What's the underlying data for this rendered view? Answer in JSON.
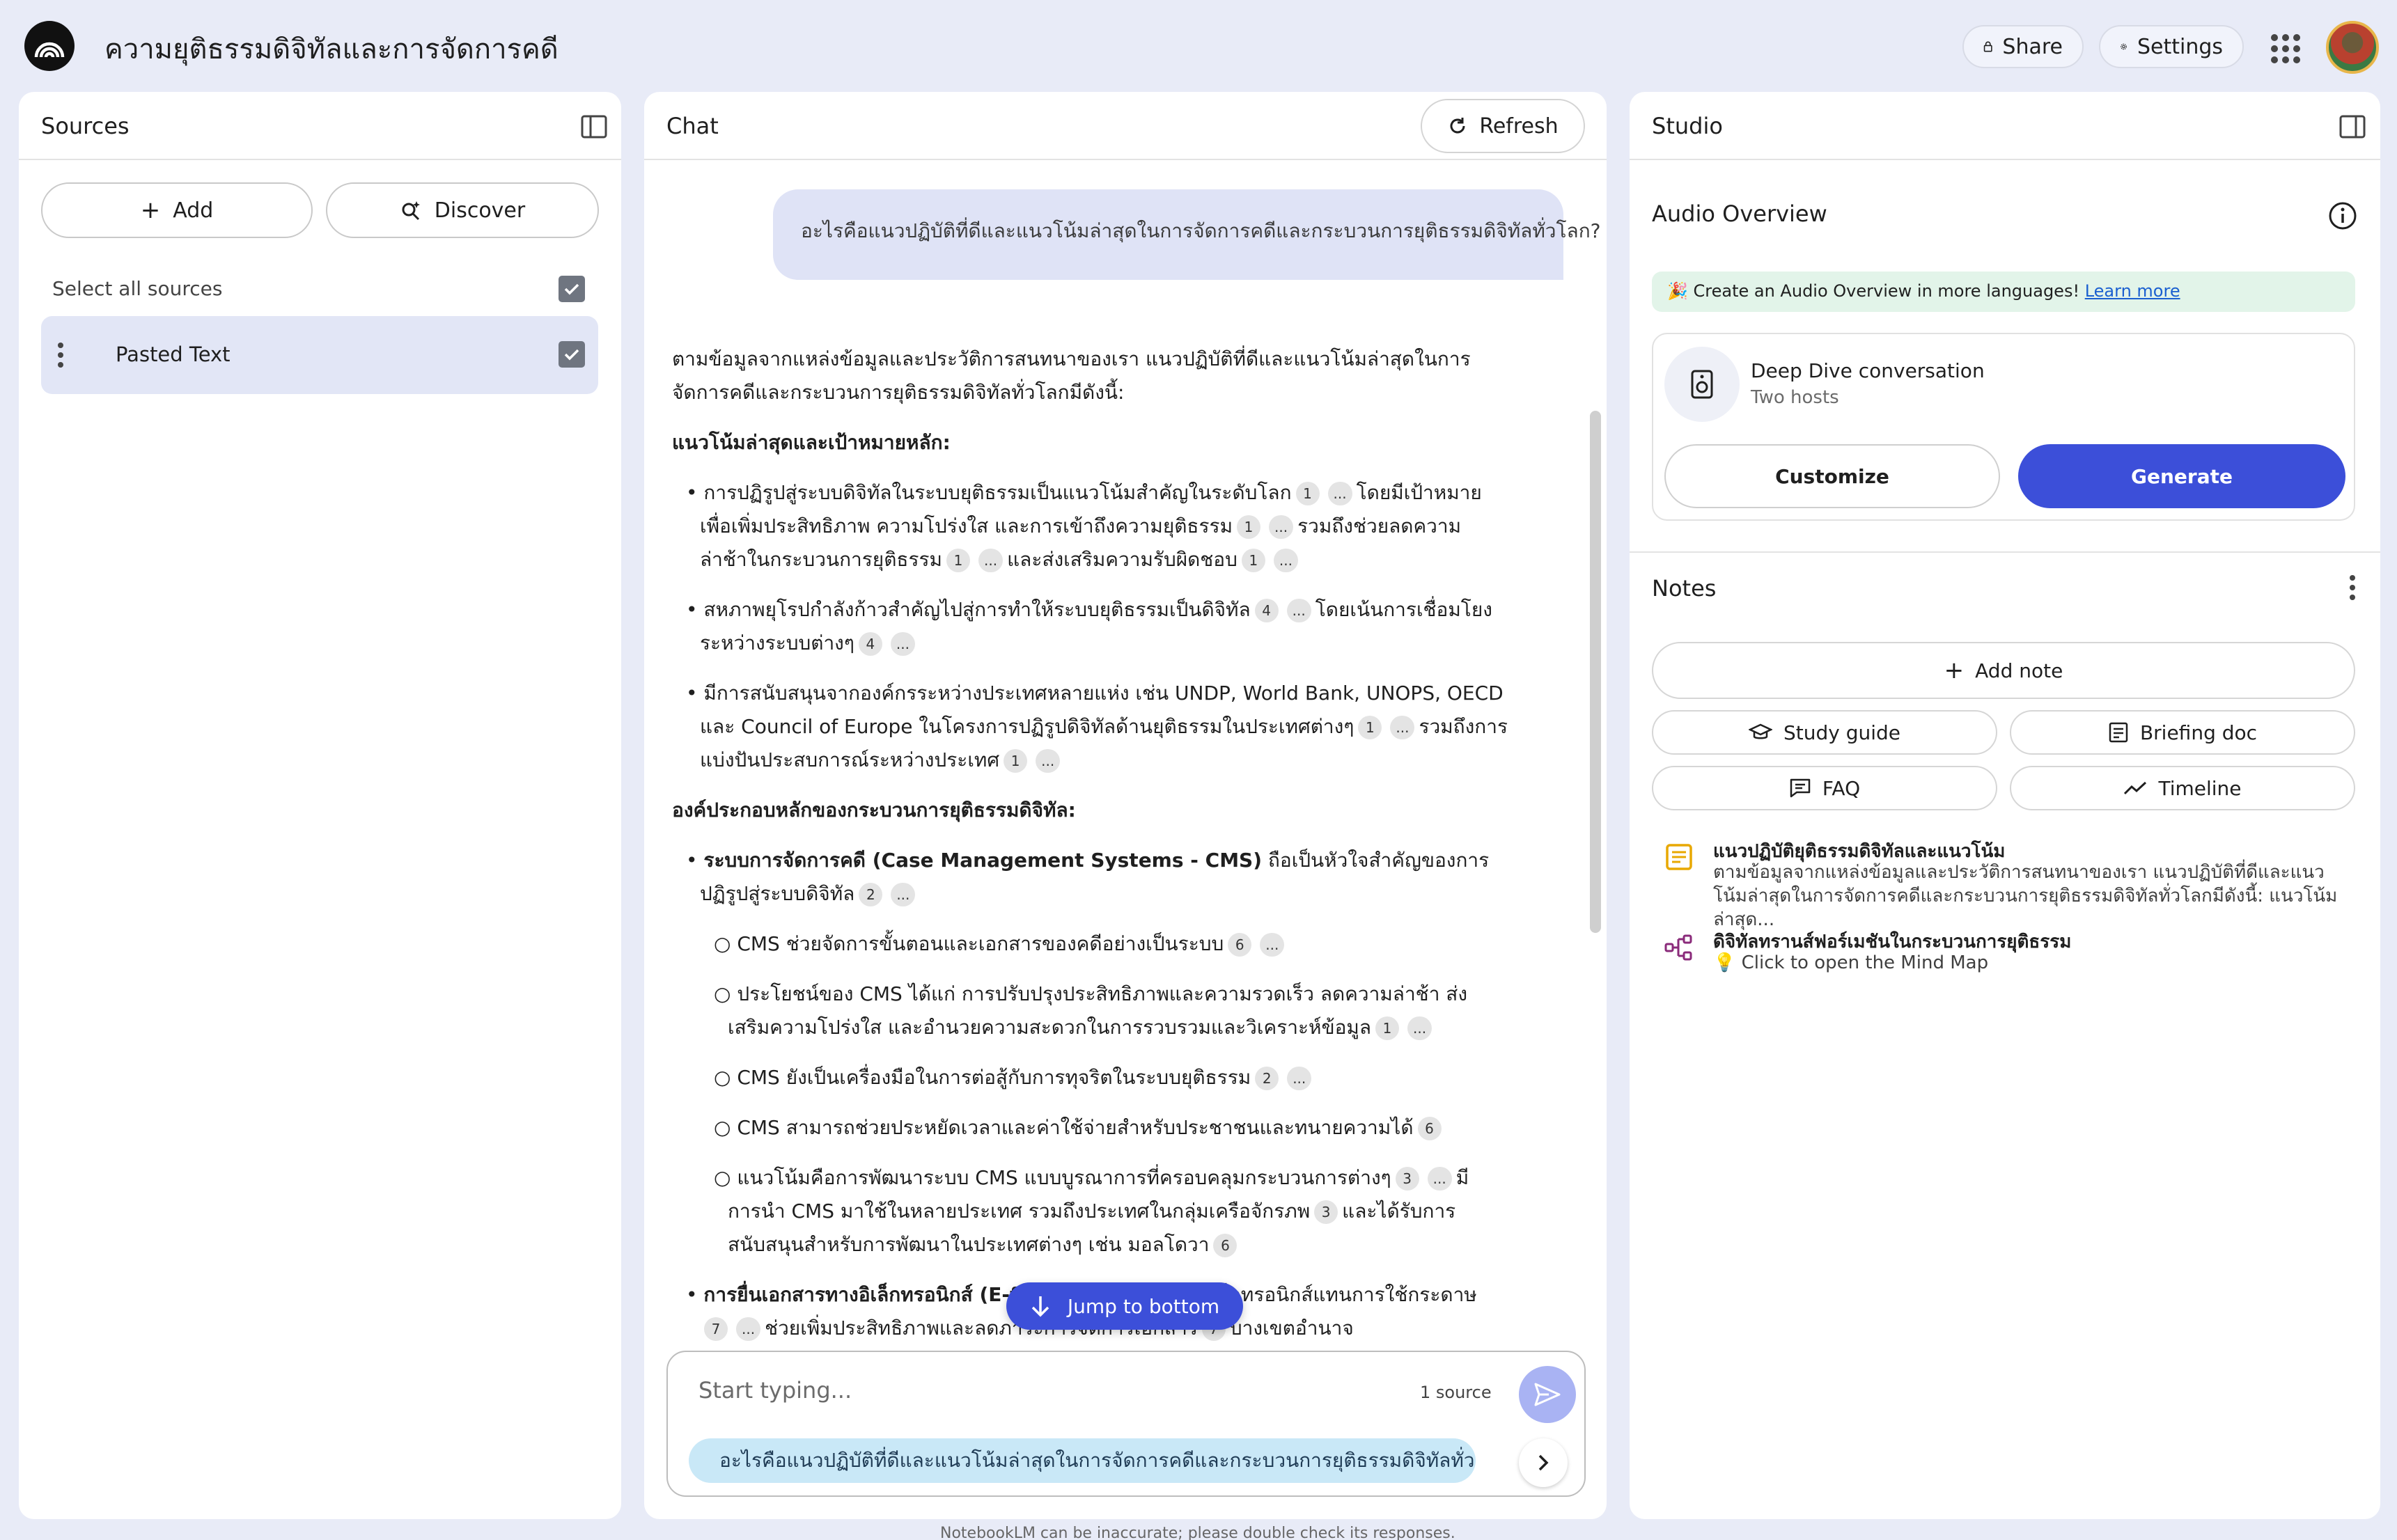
{
  "header": {
    "title": "ความยุติธรรมดิจิทัลและการจัดการคดี",
    "share_label": "Share",
    "settings_label": "Settings"
  },
  "sources": {
    "title": "Sources",
    "add_label": "Add",
    "discover_label": "Discover",
    "select_all_label": "Select all sources",
    "items": [
      {
        "label": "Pasted Text",
        "checked": true
      }
    ]
  },
  "chat": {
    "title": "Chat",
    "refresh_label": "Refresh",
    "user_question": "อะไรคือแนวปฏิบัติที่ดีและแนวโน้มล่าสุดในการจัดการคดีและกระบวนการยุติธรรมดิจิทัลทั่วโลก?",
    "answer": {
      "intro": "ตามข้อมูลจากแหล่งข้อมูลและประวัติการสนทนาของเรา แนวปฏิบัติที่ดีและแนวโน้มล่าสุดในการจัดการคดีและกระบวนการยุติธรรมดิจิทัลทั่วโลกมีดังนี้:",
      "h1": "แนวโน้มล่าสุดและเป้าหมายหลัก:",
      "b1": "การปฏิรูปสู่ระบบดิจิทัลในระบบยุติธรรมเป็นแนวโน้มสำคัญในระดับโลก",
      "b1b": "โดยมีเป้าหมายเพื่อเพิ่มประสิทธิภาพ ความโปร่งใส และการเข้าถึงความยุติธรรม",
      "b1c": "รวมถึงช่วยลดความล่าช้าในกระบวนการยุติธรรม",
      "b1d": "และส่งเสริมความรับผิดชอบ",
      "b2": "สหภาพยุโรปกำลังก้าวสำคัญไปสู่การทำให้ระบบยุติธรรมเป็นดิจิทัล",
      "b2b": "โดยเน้นการเชื่อมโยงระหว่างระบบต่างๆ",
      "b3": "มีการสนับสนุนจากองค์กรระหว่างประเทศหลายแห่ง เช่น UNDP, World Bank, UNOPS, OECD และ Council of Europe ในโครงการปฏิรูปดิจิทัลด้านยุติธรรมในประเทศต่างๆ",
      "b3b": "รวมถึงการแบ่งปันประสบการณ์ระหว่างประเทศ",
      "h2": "องค์ประกอบหลักของกระบวนการยุติธรรมดิจิทัล:",
      "b4_bold": "ระบบการจัดการคดี (Case Management Systems - CMS)",
      "b4": " ถือเป็นหัวใจสำคัญของการปฏิรูปสู่ระบบดิจิทัล",
      "s1": "CMS ช่วยจัดการขั้นตอนและเอกสารของคดีอย่างเป็นระบบ",
      "s2": "ประโยชน์ของ CMS ได้แก่ การปรับปรุงประสิทธิภาพและความรวดเร็ว ลดความล่าช้า ส่งเสริมความโปร่งใส และอำนวยความสะดวกในการรวบรวมและวิเคราะห์ข้อมูล",
      "s3": "CMS ยังเป็นเครื่องมือในการต่อสู้กับการทุจริตในระบบยุติธรรม",
      "s4": "CMS สามารถช่วยประหยัดเวลาและค่าใช้จ่ายสำหรับประชาชนและทนายความได้",
      "s5": "แนวโน้มคือการพัฒนาระบบ CMS แบบบูรณาการที่ครอบคลุมกระบวนการต่างๆ",
      "s5b": "มีการนำ CMS มาใช้ในหลายประเทศ รวมถึงประเทศในกลุ่มเครือจักรภพ",
      "s5c": "และได้รับการสนับสนุนสำหรับการพัฒนาในประเทศต่างๆ เช่น มอลโดวา",
      "b5_bold": "การยื่นเอกสารทางอิเล็กทรอนิกส์ (E-filing)",
      "b5": " และข้อมูลทางอิเล็กทรอนิกส์แทนการใช้กระดาษ",
      "b5b": "ช่วยเพิ่มประสิทธิภาพและลดภาระการจัดการเอกสาร",
      "b5c": "บางเขตอำนาจ",
      "c1": "1",
      "c2": "2",
      "c4": "4",
      "c6": "6",
      "c3": "3",
      "c7": "7",
      "more": "..."
    },
    "jump_label": "Jump to bottom",
    "input_placeholder": "Start typing...",
    "source_count": "1 source",
    "suggestion": "อะไรคือแนวปฏิบัติที่ดีและแนวโน้มล่าสุดในการจัดการคดีและกระบวนการยุติธรรมดิจิทัลทั่วโลก?",
    "disclaimer": "NotebookLM can be inaccurate; please double check its responses."
  },
  "studio": {
    "title": "Studio",
    "audio_title": "Audio Overview",
    "banner_text": "🎉 Create an Audio Overview in more languages! ",
    "banner_link": "Learn more",
    "deep_dive_title": "Deep Dive conversation",
    "deep_dive_sub": "Two hosts",
    "customize_label": "Customize",
    "generate_label": "Generate",
    "notes_title": "Notes",
    "add_note_label": "Add note",
    "study_guide_label": "Study guide",
    "briefing_doc_label": "Briefing doc",
    "faq_label": "FAQ",
    "timeline_label": "Timeline",
    "notes": [
      {
        "title": "แนวปฏิบัติยุติธรรมดิจิทัลและแนวโน้ม",
        "text": "ตามข้อมูลจากแหล่งข้อมูลและประวัติการสนทนาของเรา แนวปฏิบัติที่ดีและแนวโน้มล่าสุดในการจัดการคดีและกระบวนการยุติธรรมดิจิทัลทั่วโลกมีดังนี้: แนวโน้มล่าสุด..."
      },
      {
        "title": "ดิจิทัลทรานส์ฟอร์เมชันในกระบวนการยุติธรรม",
        "text": "💡 Click to open the Mind Map"
      }
    ]
  },
  "colors": {
    "accent": "#3c4fd9",
    "background": "#e8ebf7",
    "banner": "#e2f4e9",
    "suggestion": "#c9e8f7"
  }
}
